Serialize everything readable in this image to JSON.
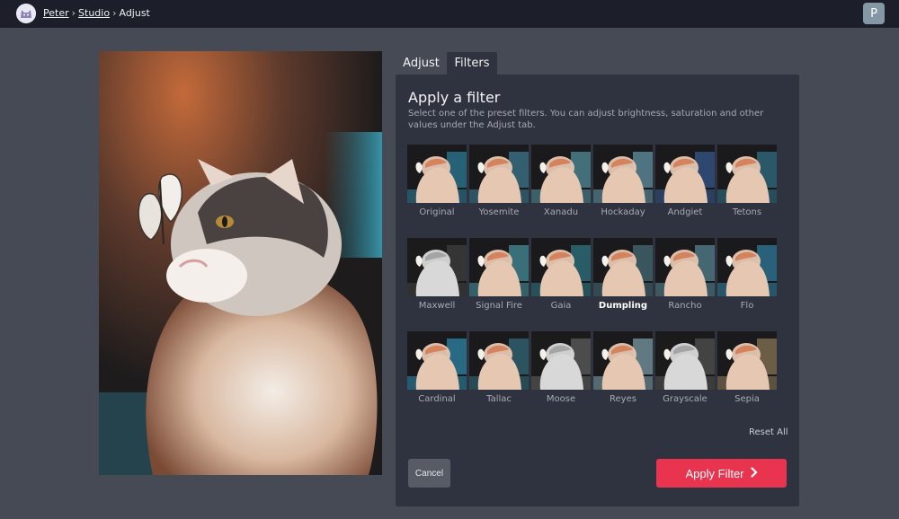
{
  "breadcrumb": {
    "items": [
      "Peter",
      "Studio",
      "Adjust"
    ],
    "separator": "›"
  },
  "user": {
    "initial": "P"
  },
  "tabs": [
    {
      "label": "Adjust",
      "active": false
    },
    {
      "label": "Filters",
      "active": true
    }
  ],
  "panel": {
    "title": "Apply a filter",
    "description": "Select one of the preset filters. You can adjust brightness, saturation and other values under the Adjust tab."
  },
  "filters": [
    {
      "label": "Original",
      "tint": "#2a6e86",
      "mono": false,
      "selected": false
    },
    {
      "label": "Yosemite",
      "tint": "#3a6c80",
      "mono": false,
      "selected": false
    },
    {
      "label": "Xanadu",
      "tint": "#4a7f8a",
      "mono": false,
      "selected": false
    },
    {
      "label": "Hockaday",
      "tint": "#5a8494",
      "mono": false,
      "selected": false
    },
    {
      "label": "Andgiet",
      "tint": "#33507d",
      "mono": false,
      "selected": false
    },
    {
      "label": "Tetons",
      "tint": "#2e6476",
      "mono": false,
      "selected": false
    },
    {
      "label": "Maxwell",
      "tint": "#3a3a3a",
      "mono": true,
      "selected": false
    },
    {
      "label": "Signal Fire",
      "tint": "#3f7f8a",
      "mono": false,
      "selected": false
    },
    {
      "label": "Gaia",
      "tint": "#2c6a74",
      "mono": false,
      "selected": false
    },
    {
      "label": "Dumpling",
      "tint": "#40606a",
      "mono": false,
      "selected": true
    },
    {
      "label": "Rancho",
      "tint": "#4d7680",
      "mono": false,
      "selected": false
    },
    {
      "label": "Flo",
      "tint": "#2d6f8c",
      "mono": false,
      "selected": false
    },
    {
      "label": "Cardinal",
      "tint": "#2b7896",
      "mono": false,
      "selected": false
    },
    {
      "label": "Tallac",
      "tint": "#2f5f6c",
      "mono": false,
      "selected": false
    },
    {
      "label": "Moose",
      "tint": "#555555",
      "mono": true,
      "selected": false
    },
    {
      "label": "Reyes",
      "tint": "#6f8c94",
      "mono": false,
      "selected": false
    },
    {
      "label": "Grayscale",
      "tint": "#4a4a4a",
      "mono": true,
      "selected": false
    },
    {
      "label": "Sepia",
      "tint": "#7a6a4e",
      "mono": false,
      "selected": false
    }
  ],
  "actions": {
    "reset_label": "Reset All",
    "cancel_label": "Cancel",
    "apply_label": "Apply Filter",
    "apply_icon": "chevron-right-icon"
  },
  "colors": {
    "accent": "#e8344f",
    "topbar": "#1c1f2a",
    "panel": "#2f333f",
    "background": "#464a55"
  }
}
